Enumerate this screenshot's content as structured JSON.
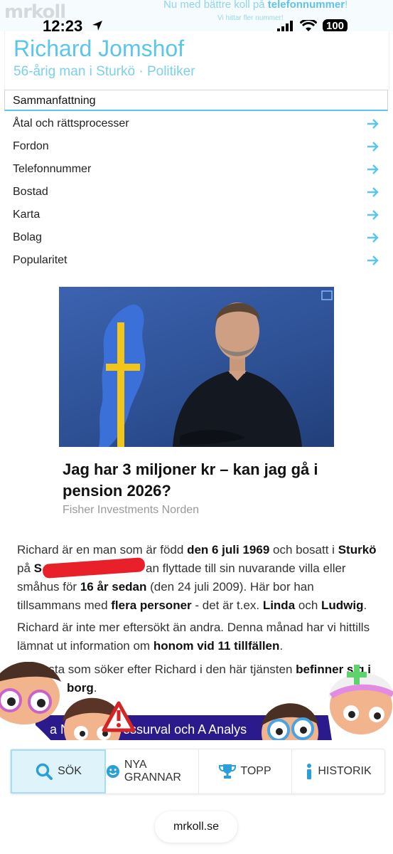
{
  "brand": {
    "logo": "mrkoll"
  },
  "promo": {
    "headline_prefix": "Nu med bättre koll på ",
    "headline_bold": "telefonnummer",
    "headline_suffix": "!",
    "subline": "Vi hittar fler nummer!"
  },
  "status_bar": {
    "time": "12:23",
    "battery": "100"
  },
  "person": {
    "name": "Richard Jomshof",
    "subtitle": "56-årig man i Sturkö · Politiker"
  },
  "nav": {
    "header": "Sammanfattning",
    "items": [
      {
        "label": "Åtal och rättsprocesser"
      },
      {
        "label": "Fordon"
      },
      {
        "label": "Telefonnummer"
      },
      {
        "label": "Bostad"
      },
      {
        "label": "Karta"
      },
      {
        "label": "Bolag"
      },
      {
        "label": "Popularitet"
      }
    ]
  },
  "ad": {
    "title": "Jag har 3 miljoner kr – kan jag gå i pension 2026?",
    "source": "Fisher Investments Norden"
  },
  "summary": {
    "p1": {
      "t1": "Richard är en man som är född ",
      "b1": "den 6 juli 1969",
      "t2": " och bosatt i ",
      "b2": "Sturkö",
      "t3": " på ",
      "b3": "S",
      "t4": "an flyttade till sin nuvarande villa eller småhus för ",
      "b4": "16 år sedan",
      "t5": " (den 24 juli 2009). Här bor han tillsammans med ",
      "b5": "flera personer",
      "t6": " - det är t.ex. ",
      "b6": "Linda",
      "t7": " och ",
      "b7": "Ludwig",
      "t8": "."
    },
    "p2": {
      "t1": "Richard är inte mer eftersökt än andra. Denna månad har vi hittills lämnat ut information om ",
      "b1": "honom vid 11 tillfällen",
      "t2": "."
    },
    "p3": {
      "t1": "De flesta som söker efter Richard i den här tjänsten ",
      "b1": "befinner sig i",
      "t2": "borg",
      "t3": "."
    }
  },
  "banner": {
    "text": "a N       istor, Adressurval och A       Analys"
  },
  "tabs": [
    {
      "label": "SÖK",
      "icon": "search-icon"
    },
    {
      "label": "NYA GRANNAR",
      "icon": "smiley-icon"
    },
    {
      "label": "TOPP",
      "icon": "trophy-icon"
    },
    {
      "label": "HISTORIK",
      "icon": "info-icon"
    }
  ],
  "browser": {
    "url": "mrkoll.se"
  },
  "colors": {
    "accent": "#5bc6ec",
    "redaction": "#e8202a",
    "banner": "#2b1a8c"
  }
}
